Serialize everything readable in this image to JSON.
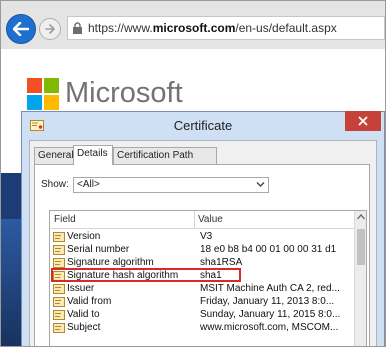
{
  "browser": {
    "url_prefix": "https://www.",
    "url_host": "microsoft.com",
    "url_path": "/en-us/default.aspx"
  },
  "page": {
    "logo_text": "Microsoft",
    "logo_colors": [
      "#f25022",
      "#7fba00",
      "#00a4ef",
      "#ffb900"
    ]
  },
  "dialog": {
    "title": "Certificate",
    "tabs": [
      {
        "label": "General",
        "active": false
      },
      {
        "label": "Details",
        "active": true
      },
      {
        "label": "Certification Path",
        "active": false
      }
    ],
    "show_label": "Show:",
    "show_value": "<All>",
    "columns": {
      "field": "Field",
      "value": "Value"
    },
    "rows": [
      {
        "field": "Version",
        "value": "V3"
      },
      {
        "field": "Serial number",
        "value": "18 e0 b8 b4 00 01 00 00 31 d1"
      },
      {
        "field": "Signature algorithm",
        "value": "sha1RSA"
      },
      {
        "field": "Signature hash algorithm",
        "value": "sha1",
        "highlighted": true
      },
      {
        "field": "Issuer",
        "value": "MSIT Machine Auth CA 2, red..."
      },
      {
        "field": "Valid from",
        "value": "Friday, January 11, 2013 8:0..."
      },
      {
        "field": "Valid to",
        "value": "Sunday, January 11, 2015 8:0..."
      },
      {
        "field": "Subject",
        "value": "www.microsoft.com, MSCOM..."
      }
    ]
  },
  "colors": {
    "accent_blue": "#1f6fcf",
    "close_red": "#c7413b",
    "highlight_red": "#d52a2a",
    "window_frame": "#cfe0f4"
  }
}
